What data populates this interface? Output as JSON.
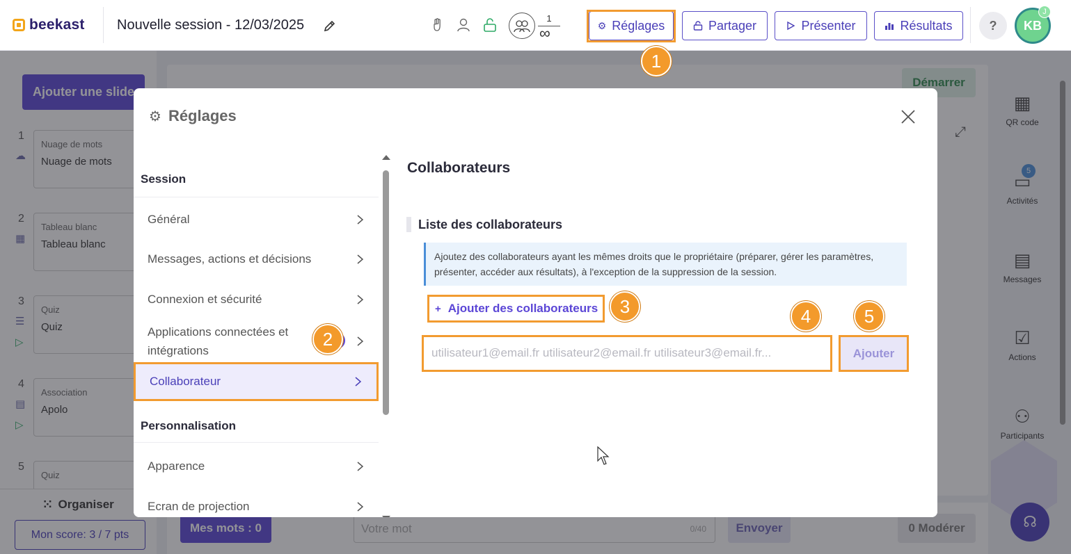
{
  "header": {
    "brand": "beekast",
    "session_title": "Nouvelle session - 12/03/2025",
    "participants": {
      "current": "1",
      "max": "∞"
    },
    "buttons": {
      "settings": "Réglages",
      "share": "Partager",
      "present": "Présenter",
      "results": "Résultats"
    },
    "help": "?",
    "avatar_initials": "KB",
    "avatar_badge": "J"
  },
  "left_panel": {
    "add_slide": "Ajouter une slide",
    "slides": [
      {
        "num": "1",
        "type": "Nuage de mots",
        "name": "Nuage de mots"
      },
      {
        "num": "2",
        "type": "Tableau blanc",
        "name": "Tableau blanc"
      },
      {
        "num": "3",
        "type": "Quiz",
        "name": "Quiz"
      },
      {
        "num": "4",
        "type": "Association",
        "name": "Apolo"
      },
      {
        "num": "5",
        "type": "Quiz",
        "name": ""
      }
    ],
    "organise": "Organiser",
    "score": "Mon score: 3 / 7 pts"
  },
  "center": {
    "start": "Démarrer",
    "my_words": "Mes mots : 0",
    "word_placeholder": "Votre mot",
    "word_counter": "0/40",
    "send": "Envoyer",
    "moderate": "0 Modérer"
  },
  "right_rail": {
    "items": [
      {
        "label": "QR code",
        "badge": ""
      },
      {
        "label": "Activités",
        "badge": "5"
      },
      {
        "label": "Messages",
        "badge": ""
      },
      {
        "label": "Actions",
        "badge": ""
      },
      {
        "label": "Participants",
        "badge": ""
      }
    ]
  },
  "modal": {
    "title": "Réglages",
    "menu": {
      "section_session": "Session",
      "items": [
        "Général",
        "Messages, actions et décisions",
        "Connexion et sécurité",
        "Applications connectées et intégrations",
        "Collaborateur"
      ],
      "section_custom": "Personnalisation",
      "custom_items": [
        "Apparence",
        "Ecran de projection"
      ],
      "active_index": 4
    },
    "content": {
      "title": "Collaborateurs",
      "list_title": "Liste des collaborateurs",
      "info": "Ajoutez des collaborateurs ayant les mêmes droits que le propriétaire (préparer, gérer les paramètres, présenter, accéder aux résultats), à l'exception de la suppression de la session.",
      "add_collaborators": "Ajouter des collaborateurs",
      "add_collaborators_prefix": "+",
      "email_placeholder": "utilisateur1@email.fr utilisateur2@email.fr utilisateur3@email.fr...",
      "add_button": "Ajouter"
    }
  },
  "steps": [
    "1",
    "2",
    "3",
    "4",
    "5"
  ],
  "colors": {
    "accent": "#5b46d6",
    "highlight": "#f29b30",
    "step_badge": "#f39a2b",
    "info_bg": "#eaf3fc"
  }
}
